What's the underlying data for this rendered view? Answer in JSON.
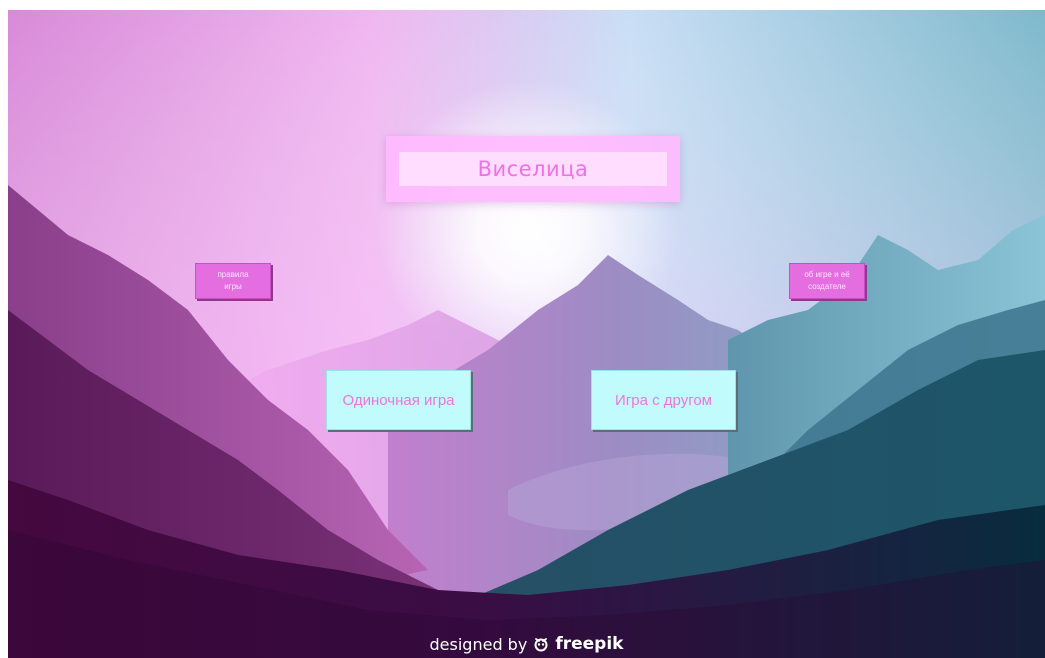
{
  "title": "Виселица",
  "buttons": {
    "rules": [
      "правила",
      "игры"
    ],
    "about": [
      "об игре и её",
      "создателе"
    ],
    "single": "Одиночная игра",
    "friend": "Игра с другом"
  },
  "credit": {
    "prefix": "designed by",
    "brand": "freepik"
  },
  "colors": {
    "title_text": "#f070e6",
    "small_button": "#e46ee0",
    "big_button": "#c2fbfb",
    "big_button_text": "#ee74de"
  },
  "icons": {
    "credit_logo": "freepik-logo-icon"
  }
}
